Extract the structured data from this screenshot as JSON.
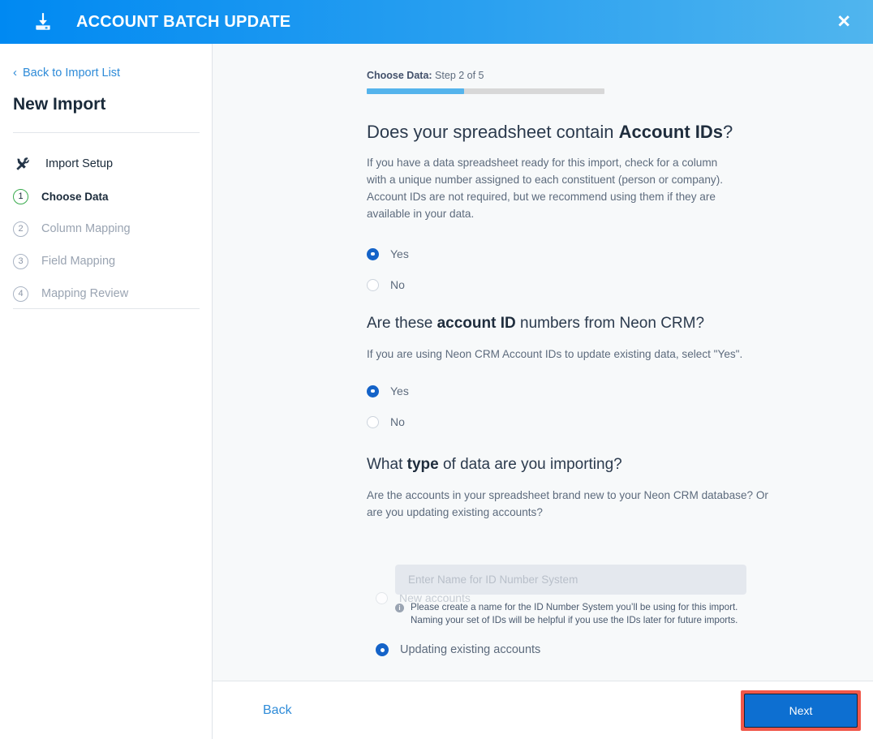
{
  "header": {
    "title": "ACCOUNT BATCH UPDATE",
    "icon": "import-download-icon",
    "close_label": "✕",
    "gradient_from": "#0089f2",
    "gradient_to": "#50b5ee"
  },
  "sidebar": {
    "back_chevron": "‹",
    "back_label": "Back to Import List",
    "heading": "New Import",
    "steps": [
      {
        "icon": "tools-icon",
        "label": "Import Setup",
        "num": "",
        "state": "setup"
      },
      {
        "icon": "",
        "label": "Choose Data",
        "num": "1",
        "state": "active"
      },
      {
        "icon": "",
        "label": "Column Mapping",
        "num": "2",
        "state": "upcoming"
      },
      {
        "icon": "",
        "label": "Field Mapping",
        "num": "3",
        "state": "upcoming"
      },
      {
        "icon": "",
        "label": "Mapping Review",
        "num": "4",
        "state": "upcoming"
      }
    ]
  },
  "main": {
    "progress": {
      "step_name": "Choose Data:",
      "step_counter": " Step 2 of 5",
      "percent": 41,
      "fill_color": "#55b4ec",
      "track_color": "#d8d8d8"
    },
    "question1": {
      "title_lead": "Does your spreadsheet contain ",
      "title_bold": "Account IDs",
      "title_tail": "?",
      "description": "If you have a data spreadsheet ready for this import, check for a column with a unique number assigned to each constituent (person or company). Account IDs are not required, but we recommend using them if they are available in your data.",
      "options": [
        {
          "label": "Yes",
          "checked": true
        },
        {
          "label": "No",
          "checked": false
        }
      ]
    },
    "question2": {
      "title_lead": "Are these ",
      "title_bold": "account ID",
      "title_tail": " numbers from Neon CRM?",
      "description": "If you are using Neon CRM Account IDs to update existing data, select \"Yes\".",
      "options": [
        {
          "label": "Yes",
          "checked": true
        },
        {
          "label": "No",
          "checked": false
        }
      ]
    },
    "question3": {
      "title_lead": "What ",
      "title_bold": "type",
      "title_tail": " of data are you importing?",
      "description": "Are the accounts in your spreadsheet brand new to your Neon CRM database? Or are you updating existing accounts?",
      "option_new": {
        "label": "New accounts",
        "checked": false,
        "disabled": true
      },
      "id_input": {
        "placeholder": "Enter Name for ID Number System",
        "value": ""
      },
      "help_icon": "info-icon",
      "help_text": "Please create a name for the ID Number System you’ll be using for this import. Naming your set of IDs will be helpful if you use the IDs later for future imports.",
      "option_update": {
        "label": "Updating existing accounts",
        "checked": true
      }
    }
  },
  "footer": {
    "back_label": "Back",
    "next_label": "Next",
    "next_highlight_color": "#f1584a",
    "next_button_color": "#0d6fd1"
  }
}
